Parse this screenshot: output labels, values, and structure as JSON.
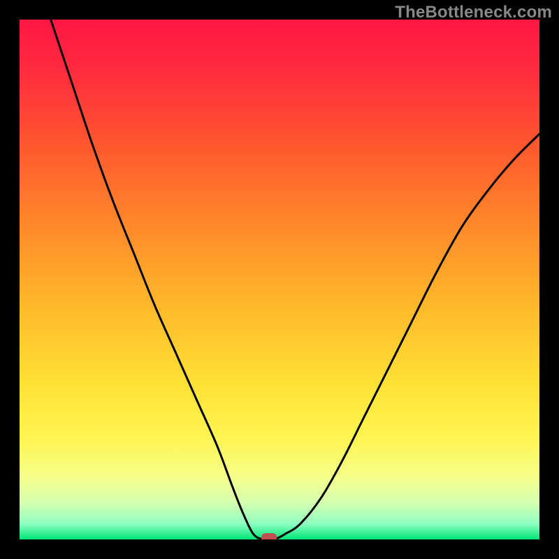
{
  "watermark": "TheBottleneck.com",
  "chart_data": {
    "type": "line",
    "title": "",
    "xlabel": "",
    "ylabel": "",
    "xlim": [
      0,
      100
    ],
    "ylim": [
      0,
      100
    ],
    "series": [
      {
        "name": "curve",
        "x": [
          6,
          10,
          14,
          18,
          22,
          26,
          30,
          34,
          38,
          41,
          43,
          45,
          47,
          49,
          51,
          54,
          58,
          62,
          66,
          70,
          75,
          80,
          85,
          90,
          95,
          100
        ],
        "y": [
          100,
          88,
          76,
          65,
          55,
          45,
          36,
          27,
          18,
          10,
          5,
          1,
          0,
          0,
          1,
          3,
          8,
          15,
          23,
          31,
          41,
          51,
          60,
          67,
          73,
          78
        ]
      }
    ],
    "marker": {
      "x": 48,
      "y": 0
    },
    "gradient_stops": [
      {
        "offset": 0.0,
        "color": "#ff1744"
      },
      {
        "offset": 0.1,
        "color": "#ff2b3e"
      },
      {
        "offset": 0.25,
        "color": "#ff5a2e"
      },
      {
        "offset": 0.4,
        "color": "#ff8a2a"
      },
      {
        "offset": 0.55,
        "color": "#ffb82a"
      },
      {
        "offset": 0.7,
        "color": "#ffe135"
      },
      {
        "offset": 0.8,
        "color": "#fff44f"
      },
      {
        "offset": 0.88,
        "color": "#f6ff8a"
      },
      {
        "offset": 0.93,
        "color": "#d4ffb0"
      },
      {
        "offset": 0.97,
        "color": "#8dffc0"
      },
      {
        "offset": 1.0,
        "color": "#00e676"
      }
    ]
  }
}
